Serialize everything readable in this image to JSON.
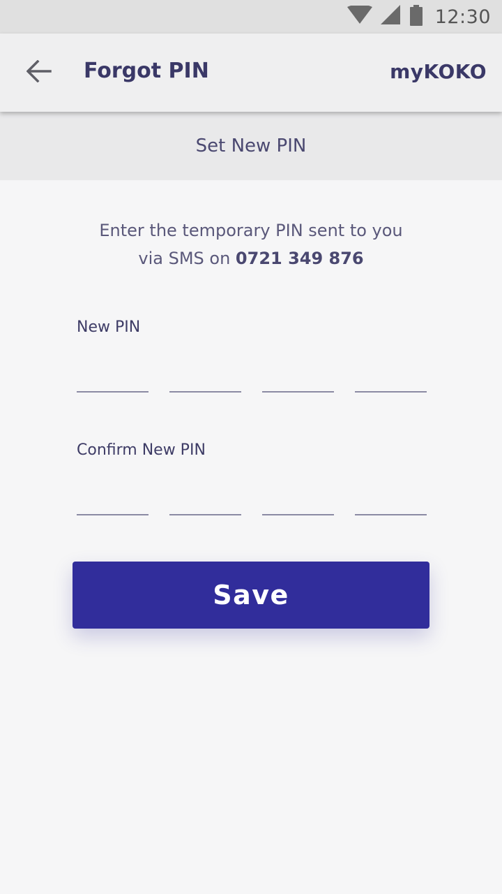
{
  "status_bar": {
    "time": "12:30",
    "icons": [
      "wifi-icon",
      "cell-signal-icon",
      "battery-icon"
    ]
  },
  "app_bar": {
    "back_icon": "arrow-left-icon",
    "title": "Forgot PIN",
    "brand": "myKOKO"
  },
  "section": {
    "title": "Set New PIN"
  },
  "instructions": {
    "line1": "Enter the temporary PIN sent to you",
    "line2_prefix": "via SMS on ",
    "phone": "0721 349 876"
  },
  "new_pin": {
    "label": "New PIN",
    "digits": [
      "",
      "",
      "",
      ""
    ]
  },
  "confirm_pin": {
    "label": "Confirm New PIN",
    "digits": [
      "",
      "",
      "",
      ""
    ]
  },
  "save_button": {
    "label": "Save"
  },
  "colors": {
    "accent": "#312d9b",
    "text_primary": "#3a3867",
    "background": "#f6f6f7",
    "status_bar": "#e0e0e0"
  }
}
